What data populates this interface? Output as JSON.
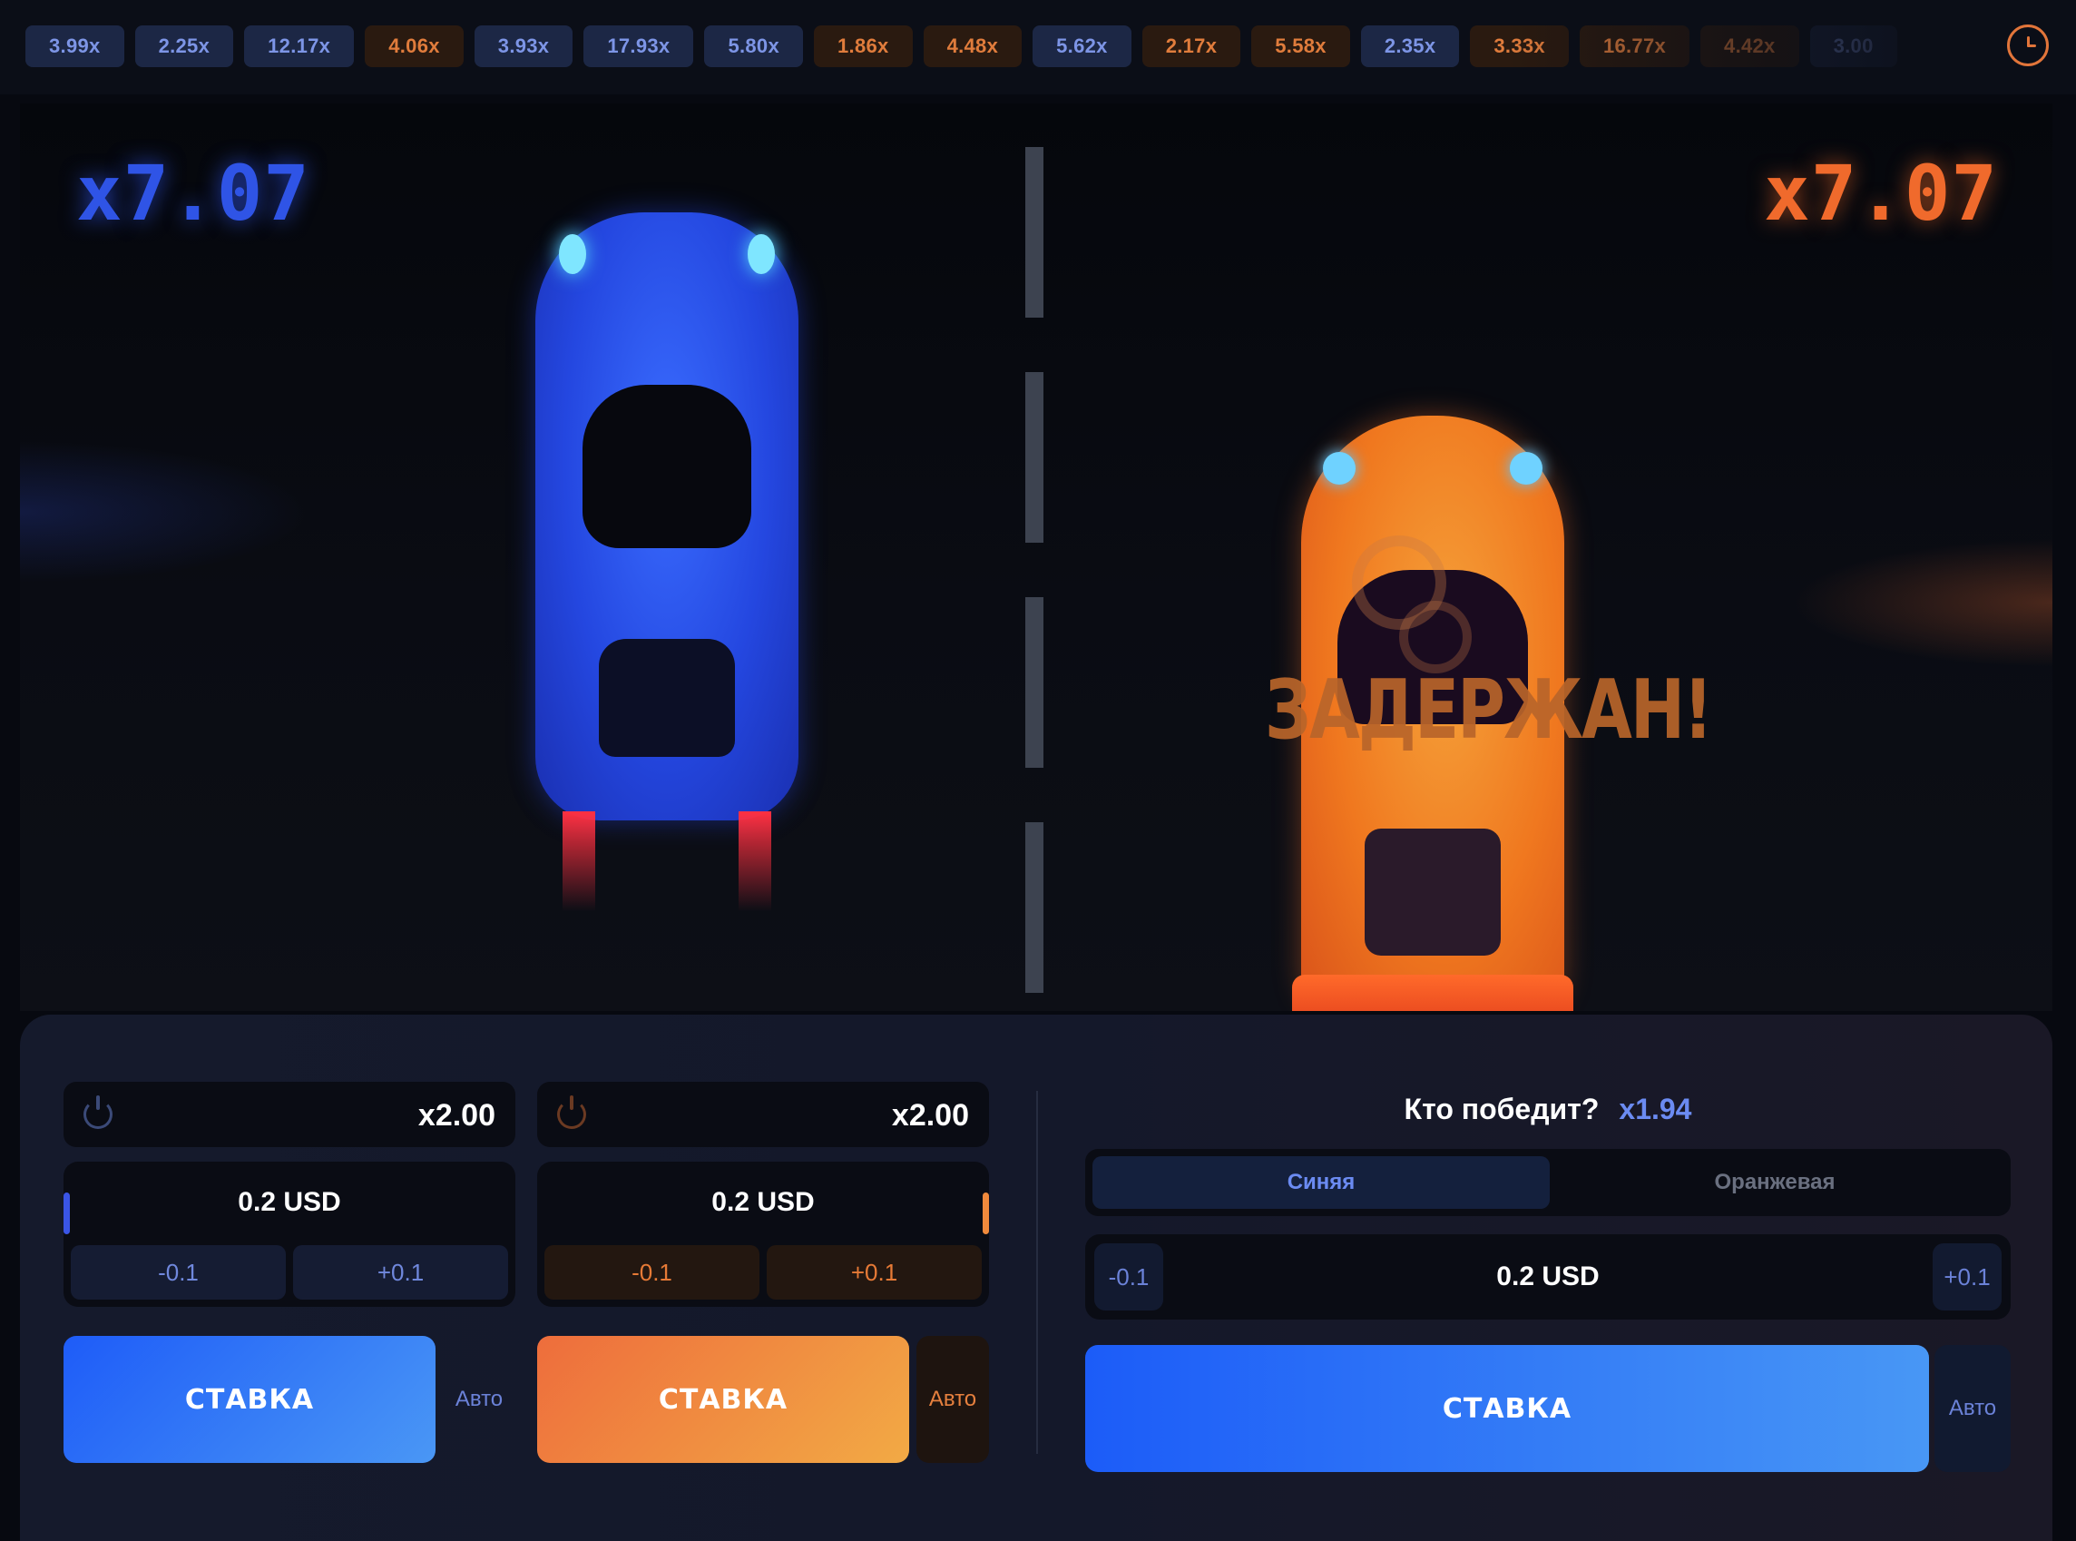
{
  "history": [
    {
      "value": "3.99x",
      "color": "blue"
    },
    {
      "value": "2.25x",
      "color": "blue"
    },
    {
      "value": "12.17x",
      "color": "blue"
    },
    {
      "value": "4.06x",
      "color": "orange"
    },
    {
      "value": "3.93x",
      "color": "blue"
    },
    {
      "value": "17.93x",
      "color": "blue"
    },
    {
      "value": "5.80x",
      "color": "blue"
    },
    {
      "value": "1.86x",
      "color": "orange"
    },
    {
      "value": "4.48x",
      "color": "orange"
    },
    {
      "value": "5.62x",
      "color": "blue"
    },
    {
      "value": "2.17x",
      "color": "orange"
    },
    {
      "value": "5.58x",
      "color": "orange"
    },
    {
      "value": "2.35x",
      "color": "blue"
    },
    {
      "value": "3.33x",
      "color": "orange"
    },
    {
      "value": "16.77x",
      "color": "orange"
    },
    {
      "value": "4.42x",
      "color": "orange"
    },
    {
      "value": "3.00",
      "color": "blue"
    }
  ],
  "icons": {
    "history": "clock-icon",
    "power": "power-icon"
  },
  "arena": {
    "blue_multiplier": "x7.07",
    "orange_multiplier": "x7.07",
    "status_text": "ЗАДЕРЖАН!"
  },
  "colors": {
    "blue": "#2f54e6",
    "orange": "#f06a2c"
  },
  "panel": {
    "blue": {
      "multiplier": "x2.00",
      "amount": "0.2 USD",
      "minus": "-0.1",
      "plus": "+0.1",
      "bet": "СТАВКА",
      "auto": "Авто"
    },
    "orange": {
      "multiplier": "x2.00",
      "amount": "0.2 USD",
      "minus": "-0.1",
      "plus": "+0.1",
      "bet": "СТАВКА",
      "auto": "Авто"
    },
    "winner": {
      "question": "Кто победит?",
      "odds": "x1.94",
      "option_blue": "Синяя",
      "option_orange": "Оранжевая",
      "amount": "0.2 USD",
      "minus": "-0.1",
      "plus": "+0.1",
      "bet": "СТАВКА",
      "auto": "Авто"
    }
  }
}
